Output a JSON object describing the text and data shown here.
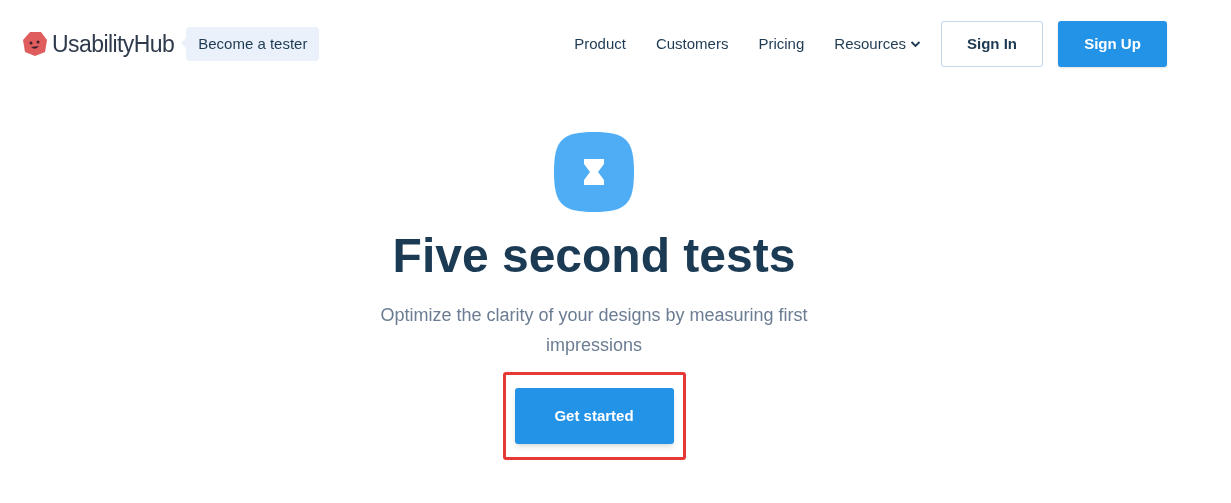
{
  "brand": {
    "name": "UsabilityHub",
    "tester_label": "Become a tester"
  },
  "nav": [
    {
      "label": "Product",
      "has_menu": false
    },
    {
      "label": "Customers",
      "has_menu": false
    },
    {
      "label": "Pricing",
      "has_menu": false
    },
    {
      "label": "Resources",
      "has_menu": true
    }
  ],
  "auth_buttons": [
    {
      "label": "Sign In",
      "kind": "outline"
    },
    {
      "label": "Sign Up",
      "kind": "primary"
    }
  ],
  "hero": {
    "title": "Five second tests",
    "subtitle": "Optimize the clarity of your designs by measuring first impressions",
    "cta": {
      "label": "Get started",
      "highlighted": true
    }
  }
}
